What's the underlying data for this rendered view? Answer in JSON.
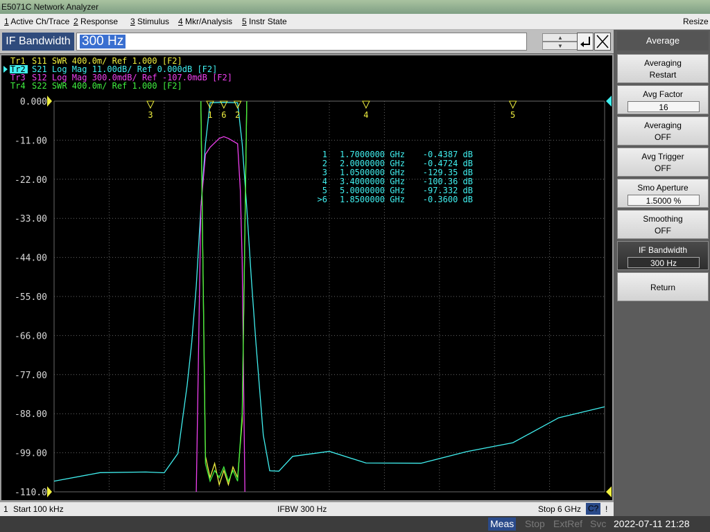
{
  "window": {
    "title": "E5071C Network Analyzer",
    "resize_label": "Resize"
  },
  "menu": [
    {
      "key": "1",
      "label": "Active Ch/Trace"
    },
    {
      "key": "2",
      "label": "Response"
    },
    {
      "key": "3",
      "label": "Stimulus"
    },
    {
      "key": "4",
      "label": "Mkr/Analysis"
    },
    {
      "key": "5",
      "label": "Instr State"
    }
  ],
  "entry": {
    "label": "IF Bandwidth",
    "value": "300 Hz"
  },
  "traces": [
    {
      "id": "Tr1",
      "desc": "S11  SWR 400.0m/ Ref 1.000 [F2]",
      "color": "#f0f040"
    },
    {
      "id": "Tr2",
      "desc": "S21  Log Mag 11.00dB/ Ref 0.000dB [F2]",
      "color": "#40f0f0",
      "active": true
    },
    {
      "id": "Tr3",
      "desc": "S12  Log Mag 300.0mdB/ Ref -107.0mdB [F2]",
      "color": "#f040f0"
    },
    {
      "id": "Tr4",
      "desc": "S22  SWR 400.0m/ Ref 1.000 [F2]",
      "color": "#40f040"
    }
  ],
  "y_ticks": [
    "0.000",
    "-11.00",
    "-22.00",
    "-33.00",
    "-44.00",
    "-55.00",
    "-66.00",
    "-77.00",
    "-88.00",
    "-99.00",
    "-110.0"
  ],
  "markers_table": [
    {
      "n": "1",
      "freq": "1.7000000 GHz",
      "val": "-0.4387 dB"
    },
    {
      "n": "2",
      "freq": "2.0000000 GHz",
      "val": "-0.4724 dB"
    },
    {
      "n": "3",
      "freq": "1.0500000 GHz",
      "val": "-129.35 dB"
    },
    {
      "n": "4",
      "freq": "3.4000000 GHz",
      "val": "-100.36 dB"
    },
    {
      "n": "5",
      "freq": "5.0000000 GHz",
      "val": "-97.332 dB"
    },
    {
      "n": ">6",
      "freq": "1.8500000 GHz",
      "val": "-0.3600 dB"
    }
  ],
  "status": {
    "channel": "1",
    "start": "Start 100 kHz",
    "ifbw": "IFBW 300 Hz",
    "stop": "Stop 6 GHz",
    "cal": "C?",
    "warn": "!"
  },
  "bottom": {
    "meas": "Meas",
    "stop": "Stop",
    "extref": "ExtRef",
    "svc": "Svc",
    "datetime": "2022-07-11 21:28"
  },
  "softkeys": {
    "title": "Average",
    "items": [
      {
        "line1": "Averaging",
        "line2": "Restart"
      },
      {
        "line1": "Avg Factor",
        "value": "16"
      },
      {
        "line1": "Averaging",
        "value": "OFF"
      },
      {
        "line1": "Avg Trigger",
        "value": "OFF"
      },
      {
        "line1": "Smo Aperture",
        "value": "1.5000  %"
      },
      {
        "line1": "Smoothing",
        "value": "OFF"
      },
      {
        "line1": "IF Bandwidth",
        "value": "300 Hz",
        "selected": true
      },
      {
        "line1": "Return"
      }
    ]
  },
  "chart_data": {
    "type": "line",
    "x_unit": "GHz",
    "xlim": [
      0.0001,
      6
    ],
    "ylim": [
      -110,
      0
    ],
    "grid": true,
    "series": [
      {
        "name": "S21",
        "color": "#40f0f0",
        "x": [
          0.0001,
          0.5,
          1.0,
          1.2,
          1.35,
          1.45,
          1.5,
          1.55,
          1.6,
          1.65,
          1.7,
          1.85,
          2.0,
          2.05,
          2.1,
          2.15,
          2.2,
          2.28,
          2.35,
          2.45,
          2.6,
          3.0,
          3.4,
          4.0,
          4.5,
          5.0,
          5.5,
          6.0
        ],
        "y": [
          -107,
          -108,
          -108,
          -105,
          -96,
          -80,
          -68,
          -52,
          -30,
          -12,
          -0.44,
          -0.36,
          -0.47,
          -12,
          -30,
          -50,
          -68,
          -90,
          -102,
          -106,
          -104,
          -101,
          -100.4,
          -98,
          -96,
          -97.3,
          -93,
          -89
        ]
      },
      {
        "name": "S12",
        "color": "#f040f0",
        "x": [
          1.55,
          1.6,
          1.65,
          1.7,
          1.8,
          1.85,
          1.9,
          2.0,
          2.03,
          2.05,
          2.08
        ],
        "y": [
          -110,
          -30,
          -15,
          -13,
          -10.5,
          -10,
          -10.5,
          -12,
          -25,
          -45,
          -110
        ]
      },
      {
        "name": "S11",
        "color": "#f0f040",
        "x": [
          1.6,
          1.65,
          1.7,
          1.75,
          1.8,
          1.85,
          1.9,
          1.95,
          2.0,
          2.05,
          2.1
        ],
        "y": [
          0,
          -100,
          -106,
          -102,
          -108,
          -104,
          -108,
          -103,
          -106,
          -90,
          0
        ]
      },
      {
        "name": "S22",
        "color": "#40f040",
        "x": [
          1.6,
          1.65,
          1.7,
          1.75,
          1.8,
          1.85,
          1.9,
          1.95,
          2.0,
          2.05,
          2.1
        ],
        "y": [
          0,
          -102,
          -107,
          -104,
          -106,
          -103,
          -107,
          -104,
          -107,
          -88,
          0
        ]
      }
    ],
    "markers": [
      {
        "label": "1",
        "x": 1.7
      },
      {
        "label": "2",
        "x": 2.0
      },
      {
        "label": "3",
        "x": 1.05
      },
      {
        "label": "4",
        "x": 3.4
      },
      {
        "label": "5",
        "x": 5.0
      },
      {
        "label": "6",
        "x": 1.85
      }
    ]
  }
}
